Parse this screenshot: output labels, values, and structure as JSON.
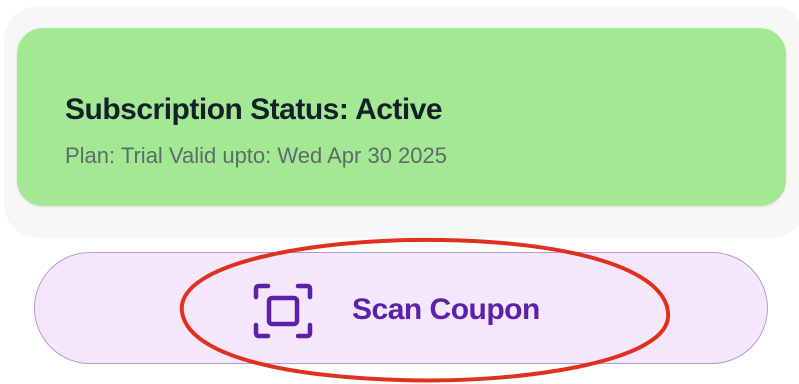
{
  "subscription": {
    "title": "Subscription Status: Active",
    "details": "Plan: Trial Valid upto: Wed Apr 30 2025"
  },
  "scan_button": {
    "label": "Scan Coupon",
    "icon": "scan-frame-icon"
  },
  "colors": {
    "status_card": "#a3e993",
    "button_background": "#f4e6fb",
    "button_border": "#b79ad1",
    "accent": "#5b21a8",
    "annotation": "#e0301e"
  }
}
